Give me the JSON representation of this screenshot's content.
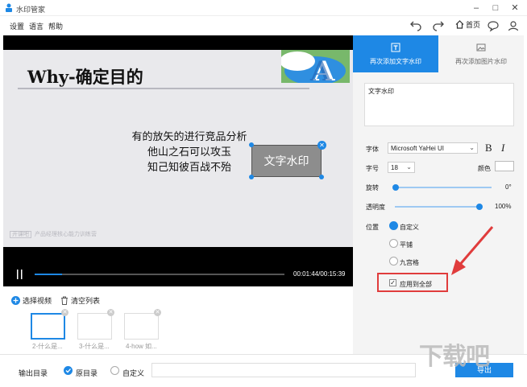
{
  "window": {
    "title": "水印管家"
  },
  "menu": [
    "设置",
    "语言",
    "帮助"
  ],
  "toolbar": {
    "home_label": "首页"
  },
  "video": {
    "slide_title": "Why-确定目的",
    "slide_lines": [
      "有的放矢的进行竞品分析",
      "他山之石可以攻玉",
      "知己知彼百战不殆"
    ],
    "watermark_text": "文字水印",
    "footer_text": "产品经理核心能力训练营",
    "time": "00:01:44/00:15:39",
    "progress_percent": 11
  },
  "list": {
    "select_video": "选择视频",
    "clear_list": "清空列表",
    "thumbnails": [
      "2-什么是...",
      "3-什么是...",
      "4-how 如..."
    ]
  },
  "output": {
    "label": "输出目录",
    "original": "原目录",
    "custom": "自定义",
    "selected": "原目录",
    "export": "导出"
  },
  "panel": {
    "tab_text": "再次添加文字水印",
    "tab_image": "再次添加图片水印",
    "active_tab": "再次添加文字水印",
    "text_value": "文字水印",
    "font_label": "字体",
    "font_value": "Microsoft YaHei UI",
    "bold": "B",
    "italic": "I",
    "size_label": "字号",
    "size_value": "18",
    "color_label": "颜色",
    "rotate_label": "旋转",
    "rotate_value": "0°",
    "opacity_label": "透明度",
    "opacity_value": "100%",
    "position_label": "位置",
    "position_options": [
      "自定义",
      "平铺",
      "九宫格"
    ],
    "position_selected": "自定义",
    "apply_all": "应用到全部",
    "apply_all_checked": true
  },
  "site_watermark": "下载吧",
  "colors": {
    "accent": "#1e88e5",
    "highlight": "#e03c3c"
  }
}
